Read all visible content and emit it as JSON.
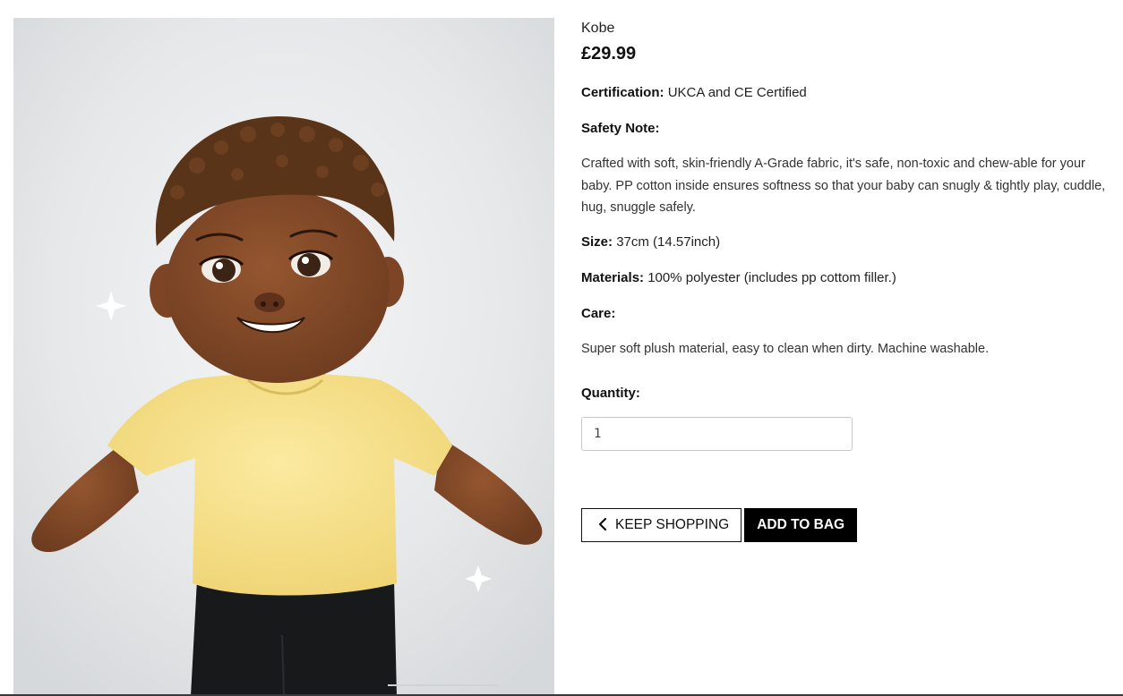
{
  "product": {
    "name": "Kobe",
    "price": "£29.99",
    "image_alt": "Kobe plush doll"
  },
  "details": {
    "certification": {
      "label": "Certification:",
      "value": "UKCA and CE Certified"
    },
    "safety_note": {
      "label": "Safety Note:",
      "text": "Crafted with soft, skin-friendly A-Grade fabric, it's safe, non-toxic and chew-able for your baby. PP cotton inside ensures softness so that your baby can snugly & tightly play, cuddle, hug, snuggle safely."
    },
    "size": {
      "label": "Size:",
      "value": "37cm (14.57inch)"
    },
    "materials": {
      "label": "Materials:",
      "value": "100% polyester (includes pp cottom filler.)"
    },
    "care": {
      "label": "Care:",
      "text": "Super soft plush material, easy to clean when dirty. Machine washable."
    }
  },
  "quantity": {
    "label": "Quantity:",
    "value": "1"
  },
  "actions": {
    "keep_shopping": {
      "label": "KEEP SHOPPING",
      "icon": "chevron-left-icon"
    },
    "add_to_bag": {
      "label": "ADD TO BAG"
    }
  },
  "colors": {
    "primary_button_bg": "#000000",
    "primary_button_text": "#ffffff",
    "doll_skin": "#7a4526",
    "doll_hair": "#5a3418",
    "doll_shirt": "#f6e08a",
    "doll_pants": "#1a1a1a"
  }
}
